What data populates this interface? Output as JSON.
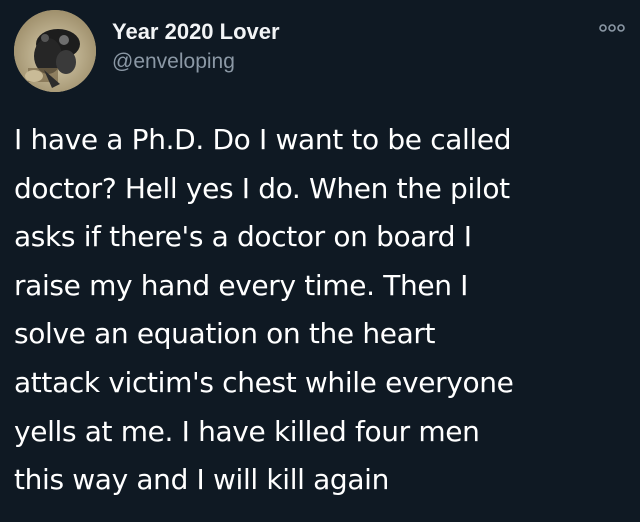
{
  "theme": {
    "background": "#0f1923",
    "text_primary": "#ffffff",
    "text_secondary": "#8b98a5"
  },
  "tweet": {
    "avatar": {
      "icon": "profile-photo"
    },
    "author": {
      "display_name": "Year 2020 Lover",
      "handle": "@enveloping"
    },
    "menu": {
      "icon": "more-options-icon"
    },
    "text": "I have a Ph.D. Do I want to be called\ndoctor? Hell yes I do. When the pilot\nasks if there's a doctor on board I\nraise my hand every time. Then I\nsolve an equation on the heart\nattack victim's chest while everyone\nyells at me. I have killed four men\nthis way and I will kill again"
  }
}
